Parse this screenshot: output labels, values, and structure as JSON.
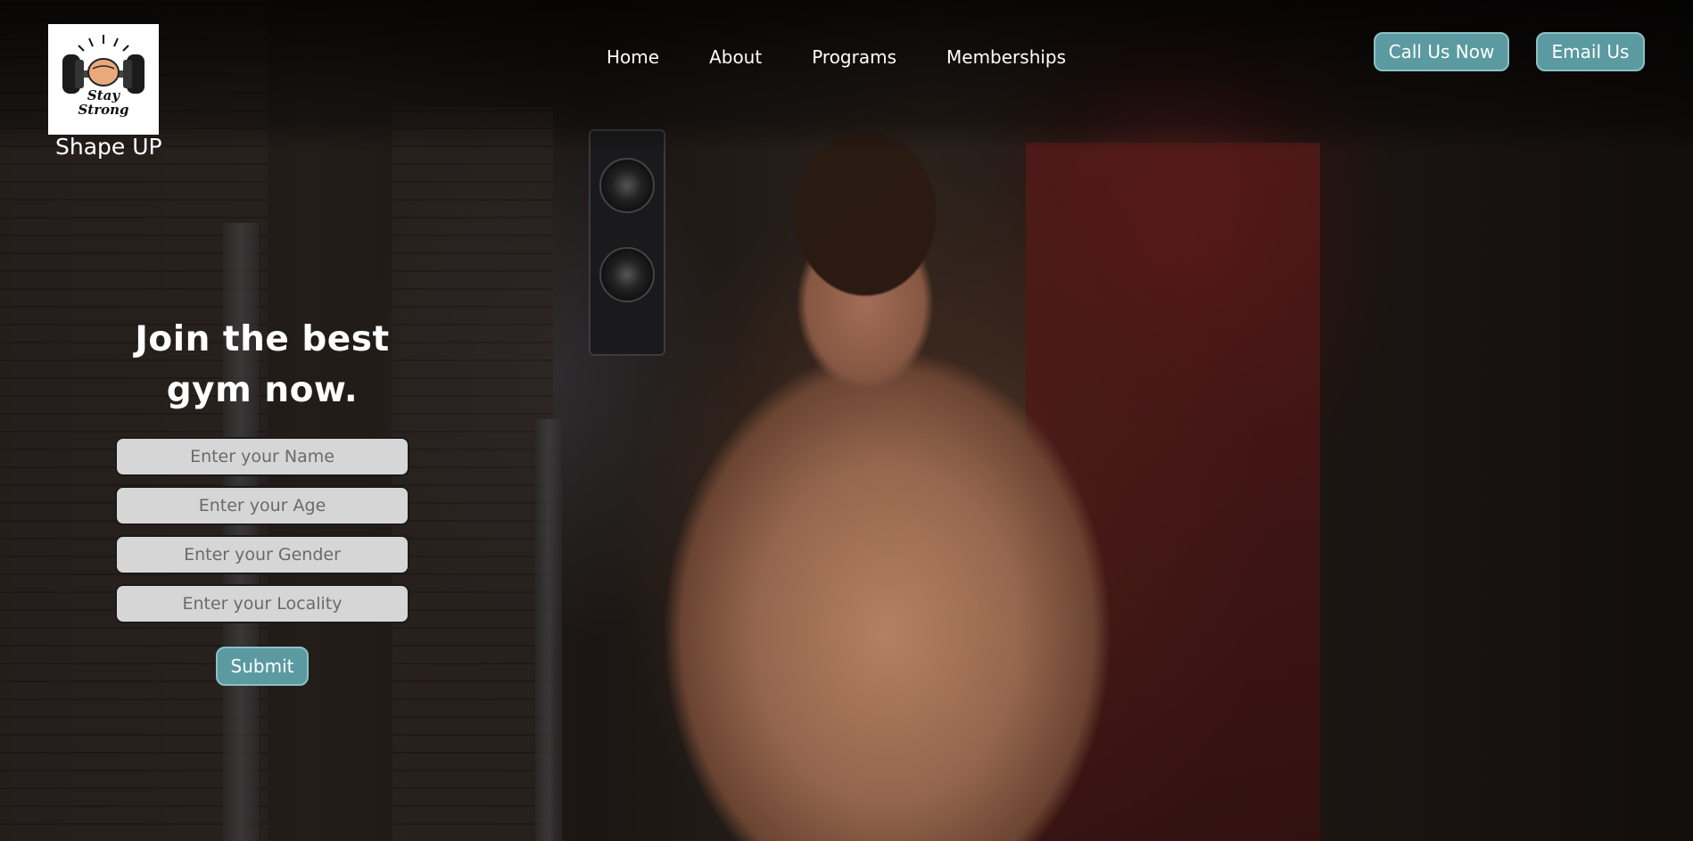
{
  "header": {
    "brand_name": "Shape UP",
    "logo_text_line1": "Stay",
    "logo_text_line2": "Strong",
    "nav": {
      "home": "Home",
      "about": "About",
      "programs": "Programs",
      "memberships": "Memberships"
    },
    "call_button": "Call Us Now",
    "email_button": "Email Us"
  },
  "signup": {
    "headline": "Join the best gym now.",
    "name_placeholder": "Enter your Name",
    "age_placeholder": "Enter your Age",
    "gender_placeholder": "Enter your Gender",
    "locality_placeholder": "Enter your Locality",
    "submit_label": "Submit"
  },
  "colors": {
    "button_teal": "#5a9aa0",
    "field_bg": "#d6d6d6",
    "text_white": "#ffffff"
  },
  "icons": {
    "logo": "dumbbell-fist-logo"
  }
}
